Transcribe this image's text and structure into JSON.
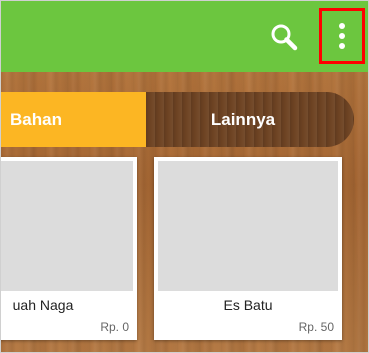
{
  "toolbar": {
    "search_icon": "search-icon",
    "menu_icon": "more-vert-icon",
    "bar_color": "#6cc63f",
    "highlight_color": "#ff0000"
  },
  "tabs": [
    {
      "label": "Bahan",
      "active": true,
      "color": "#fcb623"
    },
    {
      "label": "Lainnya",
      "active": false,
      "color": "#6e4323"
    }
  ],
  "products": [
    {
      "name": "uah Naga",
      "price": "Rp. 0"
    },
    {
      "name": "Es Batu",
      "price": "Rp. 50"
    }
  ]
}
